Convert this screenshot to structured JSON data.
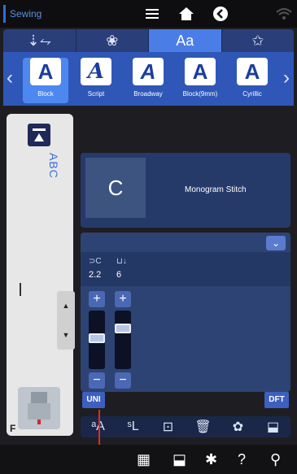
{
  "topbar": {
    "mode": "Sewing",
    "icons": [
      "menu-icon",
      "home-icon",
      "back-icon",
      "wifi-icon"
    ]
  },
  "category_tabs": [
    {
      "name": "decorative-stitch",
      "label": "⇣⥊"
    },
    {
      "name": "patterns",
      "label": "❀"
    },
    {
      "name": "fonts",
      "label": "Aa",
      "active": true
    },
    {
      "name": "favorites",
      "label": "✩"
    }
  ],
  "fonts": [
    {
      "label": "Block",
      "glyph": "A",
      "selected": true
    },
    {
      "label": "Script",
      "glyph": "A"
    },
    {
      "label": "Broadway",
      "glyph": "A"
    },
    {
      "label": "Block(9mm)",
      "glyph": "A"
    },
    {
      "label": "Cyrillic",
      "glyph": "A"
    }
  ],
  "preview": {
    "text": "ABC",
    "foot_letter": "F",
    "scroll_up": "▲",
    "scroll_down": "▼"
  },
  "stitch": {
    "char": "C",
    "name": "Monogram Stitch"
  },
  "adjust": {
    "dropdown": "⌄",
    "width_icon": "⊃C",
    "length_icon": "⊔↓",
    "width_value": "2.2",
    "length_value": "6",
    "plus": "+",
    "minus": "−"
  },
  "toolbar": {
    "uni": "UNI",
    "dft": "DFT"
  },
  "bottom_icons": [
    "preview-icon",
    "save-icon",
    "settings-icon",
    "help-icon",
    "tools-icon"
  ],
  "colors": {
    "accent": "#2f57b8",
    "panel": "#2d4373",
    "active_tab": "#4a7de6"
  }
}
